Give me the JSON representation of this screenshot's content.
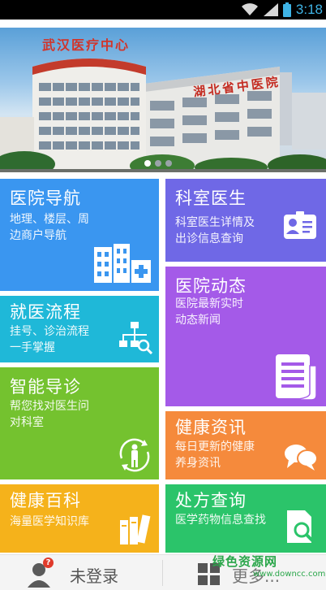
{
  "status_bar": {
    "time": "3:18",
    "accent": "#3fb4e6"
  },
  "banner": {
    "building_sign_top": "武汉医疗中心",
    "building_sign_right": "湖北省中医院",
    "slide_count": 3,
    "active_slide": 1
  },
  "tiles": {
    "hospital_nav": {
      "title": "医院导航",
      "subtitle_line1": "地理、楼层、周",
      "subtitle_line2": "边商户导航",
      "icon": "hospital-buildings-icon",
      "color": "#3a96f0"
    },
    "department_doctors": {
      "title": "科室医生",
      "subtitle_line1": "科室医生详情及",
      "subtitle_line2": "出诊信息查询",
      "icon": "doctor-badge-icon",
      "color": "#6f68e6"
    },
    "visit_process": {
      "title": "就医流程",
      "subtitle_line1": "挂号、诊治流程",
      "subtitle_line2": "一手掌握",
      "icon": "flowchart-search-icon",
      "color": "#1fb8d8"
    },
    "hospital_news": {
      "title": "医院动态",
      "subtitle_line1": "医院最新实时",
      "subtitle_line2": "动态新闻",
      "icon": "newspaper-icon",
      "color": "#a45ae8"
    },
    "smart_triage": {
      "title": "智能导诊",
      "subtitle_line1": "帮您找对医生问",
      "subtitle_line2": "对科室",
      "icon": "person-body-icon",
      "color": "#74c22f"
    },
    "health_info": {
      "title": "健康资讯",
      "subtitle_line1": "每日更新的健康",
      "subtitle_line2": "养身资讯",
      "icon": "chat-bubbles-icon",
      "color": "#f58a3c"
    },
    "health_encyclopedia": {
      "title": "健康百科",
      "subtitle_line1": "海量医学知识库",
      "icon": "books-icon",
      "color": "#f5b21b"
    },
    "prescription_query": {
      "title": "处方查询",
      "subtitle_line1": "医学药物信息查找",
      "icon": "document-search-icon",
      "color": "#2bc46a"
    }
  },
  "bottom_bar": {
    "login_label": "未登录",
    "login_badge": "?",
    "more_label": "更多...",
    "watermark": "绿色资源网",
    "watermark_url": "www.downcc.com"
  }
}
